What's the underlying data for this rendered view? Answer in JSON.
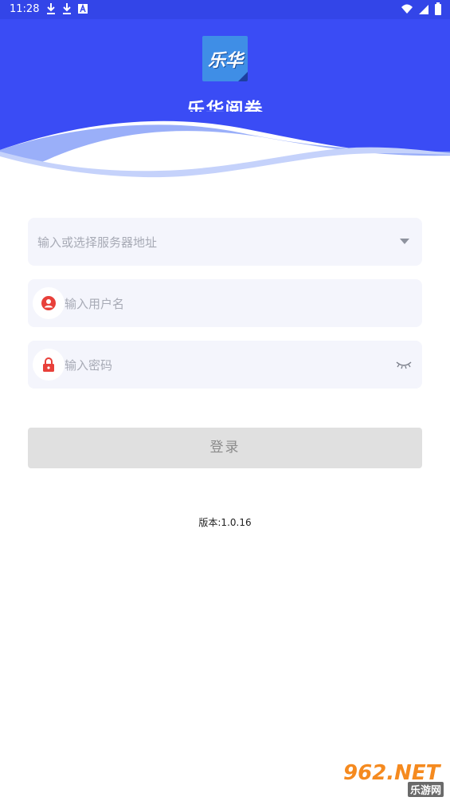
{
  "status_bar": {
    "time": "11:28",
    "left_icons": [
      "download-icon",
      "download-icon",
      "a-icon"
    ],
    "right_icons": [
      "wifi-icon",
      "signal-icon",
      "battery-icon"
    ]
  },
  "header": {
    "bg_color": "#3a4cf5",
    "logo_text": "乐华",
    "app_title": "乐华阅卷"
  },
  "form": {
    "server_placeholder": "输入或选择服务器地址",
    "username_placeholder": "输入用户名",
    "password_placeholder": "输入密码",
    "icon_color": "#e8403a",
    "login_label": "登录"
  },
  "footer": {
    "version": "版本:1.0.16"
  },
  "watermark": {
    "main": "962.NET",
    "sub": "乐游网"
  }
}
